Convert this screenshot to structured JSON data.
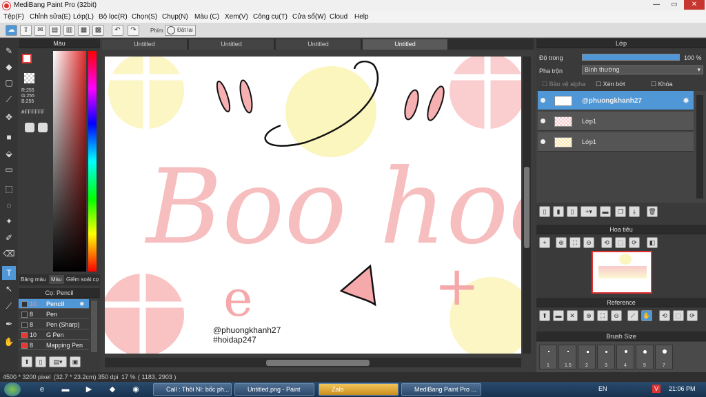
{
  "window": {
    "title": "MediBang Paint Pro (32bit)"
  },
  "menu": [
    "Tệp(F)",
    "Chỉnh sửa(E)",
    "Lớp(L)",
    "Bộ lọc(R)",
    "Chọn(S)",
    "Chụp(N)",
    "Màu (C)",
    "Xem(V)",
    "Công cụ(T)",
    "Cửa sổ(W)",
    "Cloud",
    "Help"
  ],
  "toolbar": {
    "phim_label": "Phím",
    "reset_label": "Đặt lại"
  },
  "color_panel": {
    "title": "Màu",
    "r": "R:255",
    "g": "G:255",
    "b": "B:255",
    "hex": "#FFFFFF",
    "tab1": "Bảng màu",
    "tab2": "Màu",
    "tab3": "Giếm soát cọ"
  },
  "brush_panel": {
    "title": "Cọ: Pencil",
    "items": [
      {
        "size": "10",
        "name": "Pencil",
        "color": "#333333"
      },
      {
        "size": "8",
        "name": "Pen",
        "color": "#333333"
      },
      {
        "size": "8",
        "name": "Pen (Sharp)",
        "color": "#333333"
      },
      {
        "size": "10",
        "name": "G Pen",
        "color": "#e53935"
      },
      {
        "size": "8",
        "name": "Mapping Pen",
        "color": "#e53935"
      }
    ]
  },
  "tabs": [
    "Untitled",
    "Untitled",
    "Untitled",
    "Untitled"
  ],
  "canvas": {
    "main_text": "Boo hoo",
    "credit1": "@phuongkhanh27",
    "credit2": "#hoidap247"
  },
  "layer_panel": {
    "title": "Lớp",
    "opacity_label": "Độ trong",
    "opacity_value": "100 %",
    "blend_label": "Pha trộn",
    "blend_value": "Bình thường",
    "protect_alpha": "Bảo vệ alpha",
    "clip": "Xén bớt",
    "lock": "Khóa",
    "layers": [
      {
        "name": "@phuongkhanh27"
      },
      {
        "name": "Lớp1"
      },
      {
        "name": "Lớp1"
      }
    ]
  },
  "navigator": {
    "title": "Hoa tiêu"
  },
  "reference": {
    "title": "Reference"
  },
  "brush_size": {
    "title": "Brush Size",
    "sizes": [
      "1",
      "1.5",
      "2",
      "3",
      "4",
      "5",
      "7"
    ]
  },
  "status": {
    "dims": "4500 * 3200 pixel",
    "cm": "(32.7 * 23.2cm)",
    "dpi": "350 dpi",
    "zoom": "17 %",
    "coords": "( 1183, 2903 )"
  },
  "taskbar": {
    "tasks": [
      "Call : Thôi NI: bốc ph...",
      "Untitled.png - Paint",
      "Zalo",
      "MediBang Paint Pro ..."
    ],
    "lang": "EN",
    "time": "21:06 PM"
  },
  "colors": {
    "accent": "#4f97d6",
    "pink": "#f4a7a9",
    "yellow": "#fbf5be"
  }
}
